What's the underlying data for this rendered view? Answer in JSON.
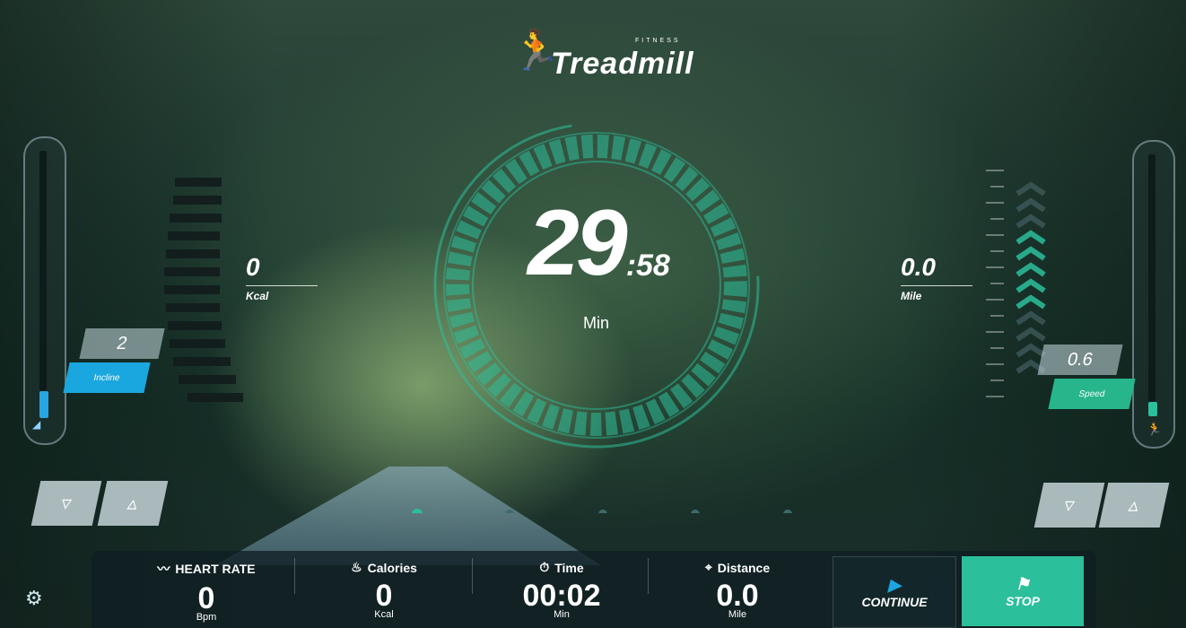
{
  "brand": {
    "small": "FITNESS",
    "name": "Treadmill"
  },
  "incline": {
    "value": "2",
    "label": "Incline",
    "fill": 0.1
  },
  "speed": {
    "value": "0.6",
    "label": "Speed",
    "fill": 0.05
  },
  "center": {
    "big": "29",
    "small": ":58",
    "unit": "Min"
  },
  "kcal_panel": {
    "value": "0",
    "unit": "Kcal"
  },
  "mile_panel": {
    "value": "0.0",
    "unit": "Mile"
  },
  "stats": [
    {
      "label": "HEART RATE",
      "value": "0",
      "unit": "Bpm",
      "icon": "heart-rate-icon"
    },
    {
      "label": "Calories",
      "value": "0",
      "unit": "Kcal",
      "icon": "flame-icon"
    },
    {
      "label": "Time",
      "value": "00:02",
      "unit": "Min",
      "icon": "stopwatch-icon"
    },
    {
      "label": "Distance",
      "value": "0.0",
      "unit": "Mile",
      "icon": "location-pin-icon"
    }
  ],
  "buttons": {
    "continue": "CONTINUE",
    "stop": "STOP"
  },
  "colors": {
    "accent": "#2bbf9b",
    "incline_tag": "#1aa6de",
    "speed_tag": "#27b58c"
  }
}
